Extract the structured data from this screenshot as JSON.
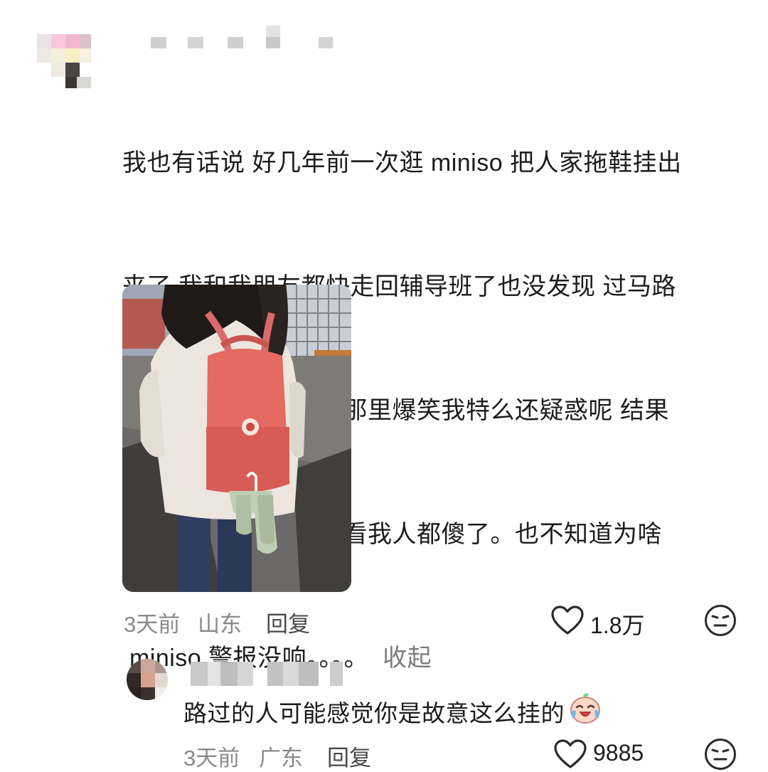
{
  "comment": {
    "lines": [
      "我也有话说 好几年前一次逛 miniso 把人家拖鞋挂出",
      "来了 我和我朋友都快走回辅导班了也没发现 过马路",
      "的时候突然我朋友在那里爆笑我特么还疑惑呢 结果",
      "给我拍了张照片给我看我人都傻了。也不知道为啥",
      " miniso 警报没响。。。。"
    ],
    "collapse_label": "收起",
    "time": "3天前",
    "location": "山东",
    "reply_label": "回复",
    "like_count": "1.8万",
    "icons": {
      "like": "heart-outline-icon",
      "dislike": "neutral-face-icon"
    }
  },
  "reply": {
    "text": "路过的人可能感觉你是故意这么挂的",
    "emoji": "laughing-crying-emoji",
    "time": "3天前",
    "location": "广东",
    "reply_label": "回复",
    "like_count": "9885"
  },
  "colors": {
    "text": "#1c1c1c",
    "meta": "#8a8a8a",
    "reply_link": "#4a4a4a",
    "background": "#ffffff"
  }
}
